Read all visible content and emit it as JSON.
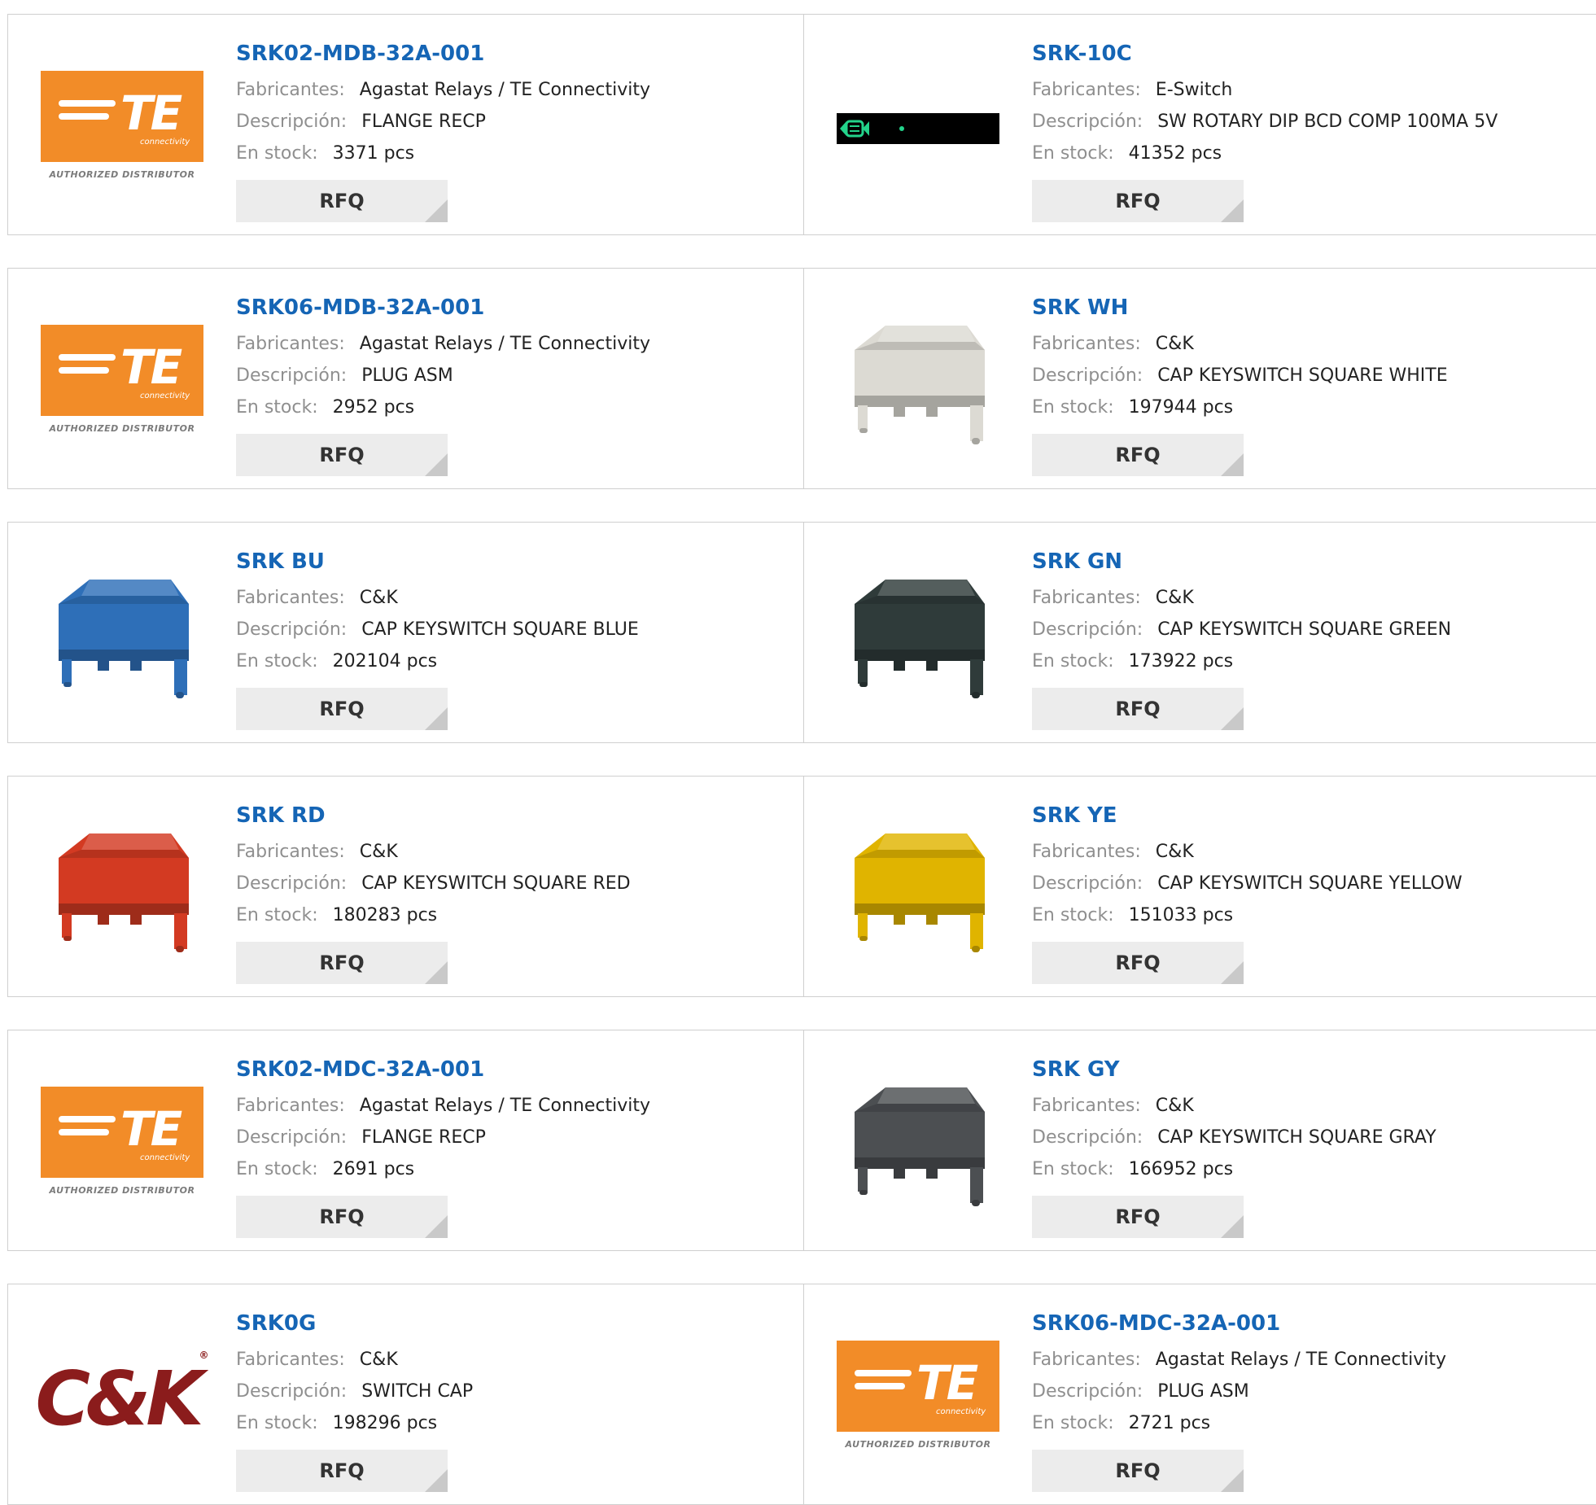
{
  "rfq_label": "RFQ",
  "labels": {
    "manufacturer": "Fabricantes:",
    "description": "Descripción:",
    "stock": "En stock:"
  },
  "te_logo": {
    "brand": "TE",
    "tagline": "connectivity",
    "authorized": "AUTHORIZED DISTRIBUTOR"
  },
  "ck_logo": {
    "brand": "C&K",
    "mark": "®"
  },
  "colors": {
    "link": "#1565b5",
    "te_orange": "#f28c28",
    "ck_red": "#8b1c1c",
    "cap_white": "#dcdad3",
    "cap_blue": "#2e6fb8",
    "cap_green": "#2f3b3a",
    "cap_red": "#d33a22",
    "cap_yellow": "#e0b400",
    "cap_gray": "#4c4f52"
  },
  "products": [
    {
      "part": "SRK02-MDB-32A-001",
      "manufacturer": "Agastat Relays / TE Connectivity",
      "description": "FLANGE RECP",
      "stock": "3371 pcs",
      "image": "te-logo"
    },
    {
      "part": "SRK-10C",
      "manufacturer": "E-Switch",
      "description": "SW ROTARY DIP BCD COMP 100MA 5V",
      "stock": "41352 pcs",
      "image": "rotary-dip"
    },
    {
      "part": "SRK06-MDB-32A-001",
      "manufacturer": "Agastat Relays / TE Connectivity",
      "description": "PLUG ASM",
      "stock": "2952 pcs",
      "image": "te-logo"
    },
    {
      "part": "SRK WH",
      "manufacturer": "C&K",
      "description": "CAP KEYSWITCH SQUARE WHITE",
      "stock": "197944 pcs",
      "image": "cap-white"
    },
    {
      "part": "SRK BU",
      "manufacturer": "C&K",
      "description": "CAP KEYSWITCH SQUARE BLUE",
      "stock": "202104 pcs",
      "image": "cap-blue"
    },
    {
      "part": "SRK GN",
      "manufacturer": "C&K",
      "description": "CAP KEYSWITCH SQUARE GREEN",
      "stock": "173922 pcs",
      "image": "cap-green"
    },
    {
      "part": "SRK RD",
      "manufacturer": "C&K",
      "description": "CAP KEYSWITCH SQUARE RED",
      "stock": "180283 pcs",
      "image": "cap-red"
    },
    {
      "part": "SRK YE",
      "manufacturer": "C&K",
      "description": "CAP KEYSWITCH SQUARE YELLOW",
      "stock": "151033 pcs",
      "image": "cap-yellow"
    },
    {
      "part": "SRK02-MDC-32A-001",
      "manufacturer": "Agastat Relays / TE Connectivity",
      "description": "FLANGE RECP",
      "stock": "2691 pcs",
      "image": "te-logo"
    },
    {
      "part": "SRK GY",
      "manufacturer": "C&K",
      "description": "CAP KEYSWITCH SQUARE GRAY",
      "stock": "166952 pcs",
      "image": "cap-gray"
    },
    {
      "part": "SRK0G",
      "manufacturer": "C&K",
      "description": "SWITCH CAP",
      "stock": "198296 pcs",
      "image": "ck-logo"
    },
    {
      "part": "SRK06-MDC-32A-001",
      "manufacturer": "Agastat Relays / TE Connectivity",
      "description": "PLUG ASM",
      "stock": "2721 pcs",
      "image": "te-logo"
    }
  ]
}
